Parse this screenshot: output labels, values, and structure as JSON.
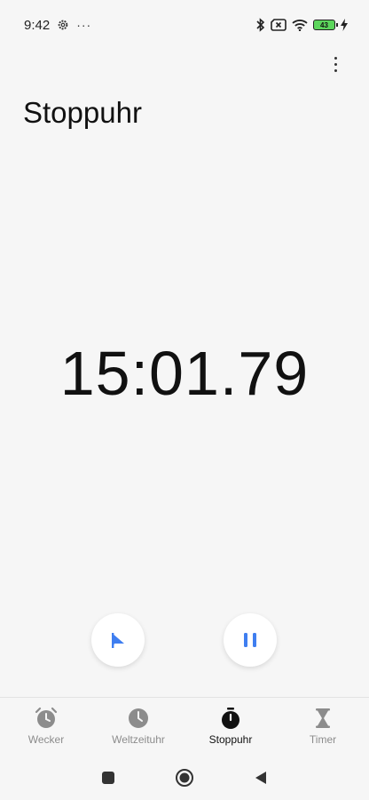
{
  "status": {
    "time": "9:42",
    "overflow": "···",
    "battery": "43"
  },
  "header": {
    "title": "Stoppuhr"
  },
  "stopwatch": {
    "elapsed": "15:01.79"
  },
  "tabs": [
    {
      "label": "Wecker",
      "icon": "alarm-icon"
    },
    {
      "label": "Weltzeituhr",
      "icon": "clock-icon"
    },
    {
      "label": "Stoppuhr",
      "icon": "stopwatch-icon",
      "active": true
    },
    {
      "label": "Timer",
      "icon": "hourglass-icon"
    }
  ],
  "colors": {
    "accent": "#3f7ef0",
    "background": "#f6f6f6",
    "inactive": "#8c8c8c"
  }
}
